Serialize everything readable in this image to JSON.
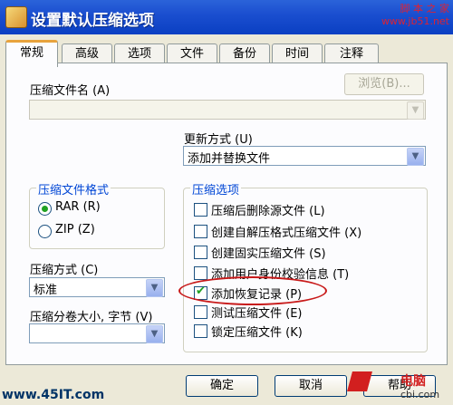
{
  "window": {
    "title": "设置默认压缩选项",
    "watermark_top": "脚 本 之 家",
    "watermark_top_url": "www.jb51.net"
  },
  "tabs": [
    {
      "label": "常规",
      "active": true
    },
    {
      "label": "高级"
    },
    {
      "label": "选项"
    },
    {
      "label": "文件"
    },
    {
      "label": "备份"
    },
    {
      "label": "时间"
    },
    {
      "label": "注释"
    }
  ],
  "archive_name": {
    "label": "压缩文件名 (A)",
    "value": "",
    "browse_label": "浏览(B)..."
  },
  "update_mode": {
    "label": "更新方式 (U)",
    "value": "添加并替换文件"
  },
  "archive_format": {
    "title": "压缩文件格式",
    "options": [
      {
        "label": "RAR (R)",
        "selected": true
      },
      {
        "label": "ZIP (Z)",
        "selected": false
      }
    ]
  },
  "compression_options": {
    "title": "压缩选项",
    "items": [
      {
        "label": "压缩后删除源文件 (L)",
        "checked": false
      },
      {
        "label": "创建自解压格式压缩文件 (X)",
        "checked": false
      },
      {
        "label": "创建固实压缩文件 (S)",
        "checked": false
      },
      {
        "label": "添加用户身份校验信息 (T)",
        "checked": false
      },
      {
        "label": "添加恢复记录 (P)",
        "checked": true
      },
      {
        "label": "测试压缩文件 (E)",
        "checked": false
      },
      {
        "label": "锁定压缩文件 (K)",
        "checked": false
      }
    ]
  },
  "compression_method": {
    "label": "压缩方式 (C)",
    "value": "标准"
  },
  "split_size": {
    "label": "压缩分卷大小, 字节 (V)",
    "value": ""
  },
  "buttons": {
    "ok": "确定",
    "cancel": "取消",
    "help": "帮助"
  },
  "watermarks": {
    "left": "www.45IT.com",
    "right_brand": "电脑",
    "right_url": "cbi.com"
  },
  "colors": {
    "titlebar": "#0a3fc2",
    "group_title": "#0046d5",
    "highlight_ellipse": "#c81a1a"
  }
}
